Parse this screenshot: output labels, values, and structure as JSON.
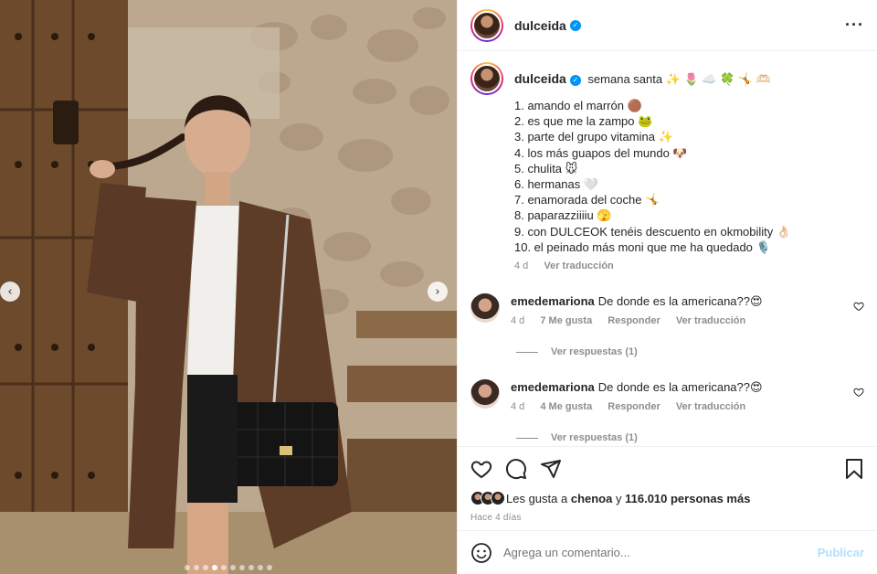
{
  "post": {
    "username": "dulceida",
    "caption_title": "semana santa ✨ 🌷 ☁️ 🍀 🤸 🫶🏻",
    "items": [
      "1. amando el marrón 🟤",
      "2. es que me la zampo 🐸",
      "3. parte del grupo vitamina ✨",
      "4. los más guapos del mundo 🐶",
      "5. chulita 🐭",
      "6. hermanas 🤍",
      "7. enamorada del coche 🤸",
      "8. paparazziiiiu 🫣",
      "9. con DULCEOK tenéis descuento en okmobility 👌🏻",
      "10. el peinado más moni que me ha quedado 🎙️"
    ],
    "caption_meta": {
      "time": "4 d",
      "translate": "Ver traducción"
    }
  },
  "comments": [
    {
      "username": "emedemariona",
      "text": "De donde es la americana??😍",
      "time": "4 d",
      "likes": "7 Me gusta",
      "reply": "Responder",
      "translate": "Ver traducción",
      "replies": "Ver respuestas (1)"
    },
    {
      "username": "emedemariona",
      "text": "De donde es la americana??😍",
      "time": "4 d",
      "likes": "4 Me gusta",
      "reply": "Responder",
      "translate": "Ver traducción",
      "replies": "Ver respuestas (1)"
    }
  ],
  "likes": {
    "prefix": "Les gusta a",
    "user": "chenoa",
    "joiner": "y",
    "count": "116.010 personas más"
  },
  "ago": "Hace 4 días",
  "add_comment": {
    "placeholder": "Agrega un comentario...",
    "publish": "Publicar"
  },
  "carousel": {
    "total": 10,
    "active": 3
  },
  "colors": {
    "accent": "#0095f6",
    "publish_disabled": "#b2dffc",
    "muted": "#8e8e8e"
  },
  "icons": [
    "more-icon",
    "verified-icon",
    "heart-icon",
    "comment-icon",
    "share-icon",
    "bookmark-icon",
    "emoji-icon",
    "prev-icon",
    "next-icon"
  ]
}
